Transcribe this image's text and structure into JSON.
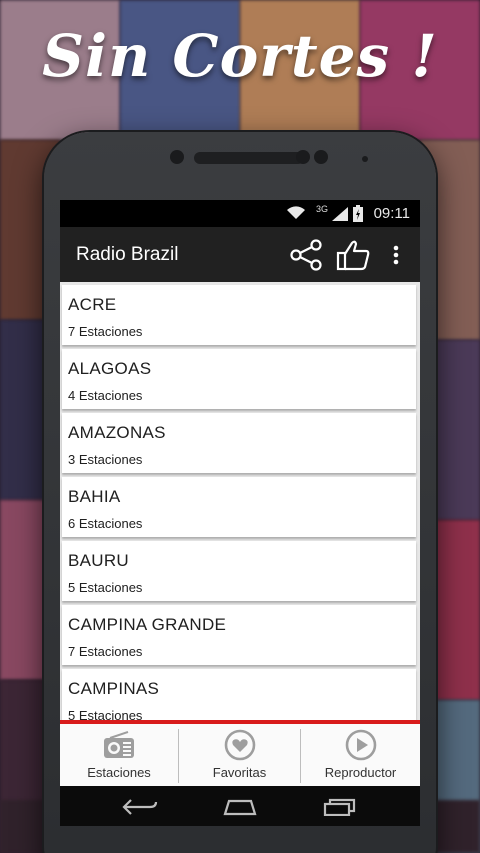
{
  "promo": {
    "headline": "Sin Cortes !"
  },
  "status_bar": {
    "time": "09:11",
    "network": "3G",
    "icons": [
      "wifi-icon",
      "signal-icon",
      "battery-icon"
    ]
  },
  "app_bar": {
    "title": "Radio Brazil",
    "actions": [
      "share-icon",
      "thumbs-up-icon",
      "overflow-menu-icon"
    ]
  },
  "regions": [
    {
      "name": "ACRE",
      "count": "7 Estaciones"
    },
    {
      "name": "ALAGOAS",
      "count": "4 Estaciones"
    },
    {
      "name": "AMAZONAS",
      "count": "3 Estaciones"
    },
    {
      "name": "BAHIA",
      "count": "6 Estaciones"
    },
    {
      "name": "BAURU",
      "count": "5 Estaciones"
    },
    {
      "name": "CAMPINA GRANDE",
      "count": "7 Estaciones"
    },
    {
      "name": "CAMPINAS",
      "count": "5 Estaciones"
    }
  ],
  "tabs": [
    {
      "label": "Estaciones",
      "icon": "radio-icon"
    },
    {
      "label": "Favoritas",
      "icon": "heart-icon"
    },
    {
      "label": "Reproductor",
      "icon": "play-icon"
    }
  ],
  "nav_bar": {
    "icons": [
      "back-icon",
      "home-icon",
      "recents-icon"
    ]
  },
  "colors": {
    "accent": "#d81b1b",
    "app_bar": "#212121",
    "icon_gray": "#9e9e9e"
  }
}
